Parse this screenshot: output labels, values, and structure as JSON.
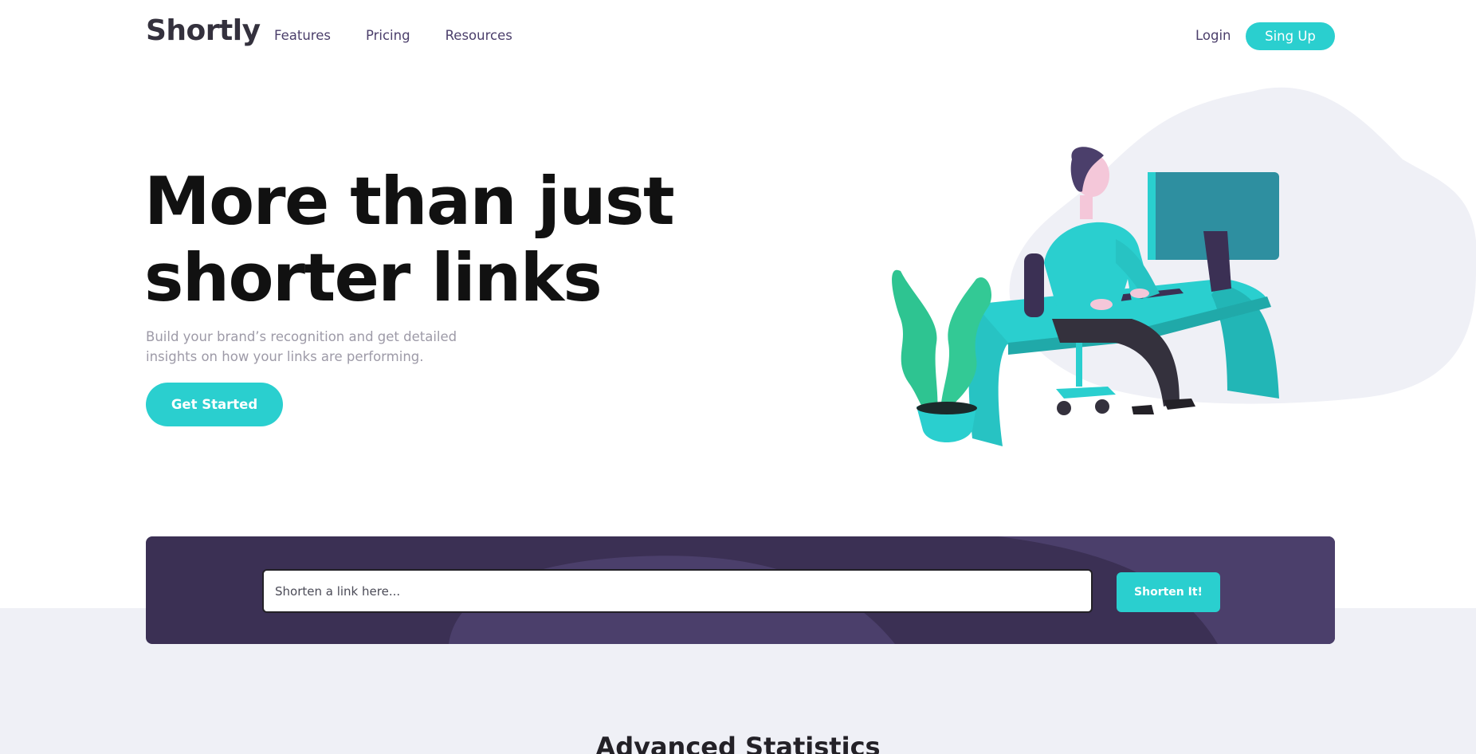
{
  "header": {
    "logo": "Shortly",
    "nav": [
      "Features",
      "Pricing",
      "Resources"
    ],
    "login_label": "Login",
    "signup_label": "Sing Up"
  },
  "hero": {
    "title": "More than just shorter links",
    "subtitle": "Build your brand’s recognition and get detailed insights on how your links are performing.",
    "cta_label": "Get Started",
    "illustration_icon": "person-working-at-desk-illustration"
  },
  "shorten": {
    "placeholder": "Shorten a link here...",
    "button_label": "Shorten It!"
  },
  "stats": {
    "title": "Advanced Statistics"
  },
  "colors": {
    "accent": "#2acfcf",
    "dark_violet": "#3b3054",
    "grayish_violet": "#9d9aa7",
    "very_dark_blue": "#34313d",
    "light_band": "#eff0f6"
  }
}
